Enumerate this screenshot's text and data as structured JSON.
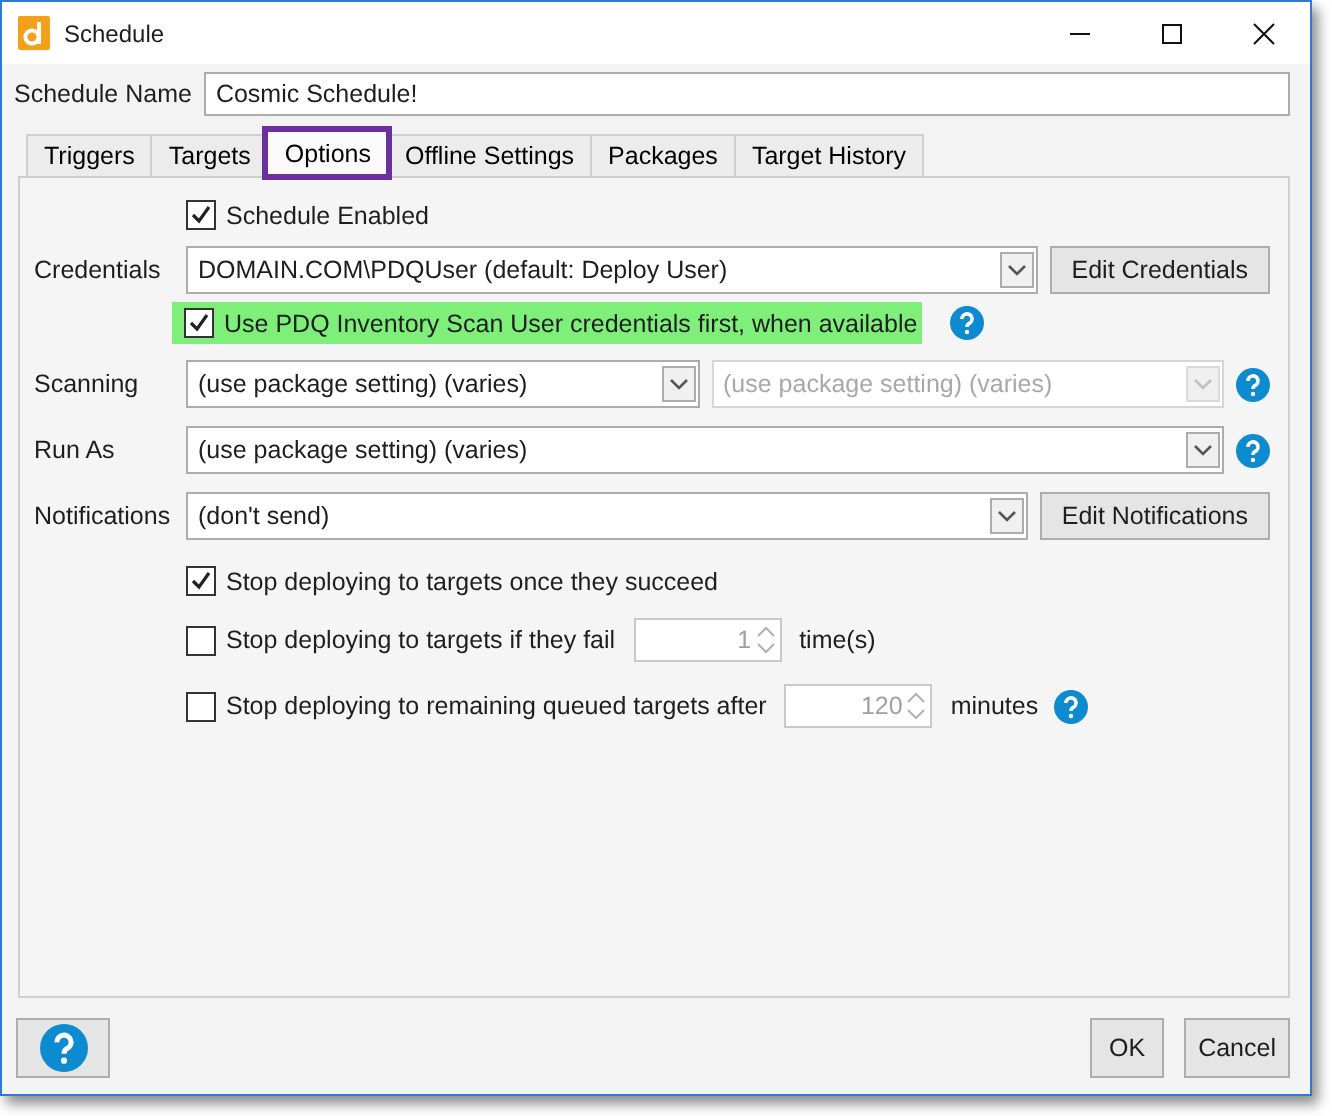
{
  "window": {
    "title": "Schedule"
  },
  "schedule_name": {
    "label": "Schedule Name",
    "value": "Cosmic Schedule!"
  },
  "tabs": [
    {
      "label": "Triggers",
      "selected": false,
      "highlighted": false
    },
    {
      "label": "Targets",
      "selected": false,
      "highlighted": false
    },
    {
      "label": "Options",
      "selected": true,
      "highlighted": true
    },
    {
      "label": "Offline Settings",
      "selected": false,
      "highlighted": false
    },
    {
      "label": "Packages",
      "selected": false,
      "highlighted": false
    },
    {
      "label": "Target History",
      "selected": false,
      "highlighted": false
    }
  ],
  "schedule_enabled": {
    "label": "Schedule Enabled",
    "checked": true
  },
  "credentials": {
    "label": "Credentials",
    "value": "DOMAIN.COM\\PDQUser (default: Deploy User)",
    "button": "Edit Credentials"
  },
  "use_scan_user": {
    "label": "Use PDQ Inventory Scan User credentials first, when available",
    "checked": true,
    "highlighted": true
  },
  "scanning": {
    "label": "Scanning",
    "value": "(use package setting) (varies)",
    "secondary_value": "(use package setting) (varies)",
    "secondary_disabled": true
  },
  "run_as": {
    "label": "Run As",
    "value": "(use package setting) (varies)"
  },
  "notifications": {
    "label": "Notifications",
    "value": "(don't send)",
    "button": "Edit Notifications"
  },
  "stop_options": [
    {
      "label": "Stop deploying to targets once they succeed",
      "checked": true
    },
    {
      "label": "Stop deploying to targets if they fail",
      "checked": false,
      "spinner": {
        "value": "1",
        "disabled": true,
        "unit": "time(s)"
      }
    },
    {
      "label": "Stop deploying to remaining queued targets after",
      "checked": false,
      "spinner": {
        "value": "120",
        "disabled": true,
        "unit": "minutes"
      },
      "help": true
    }
  ],
  "buttons": [
    "OK",
    "Cancel"
  ]
}
